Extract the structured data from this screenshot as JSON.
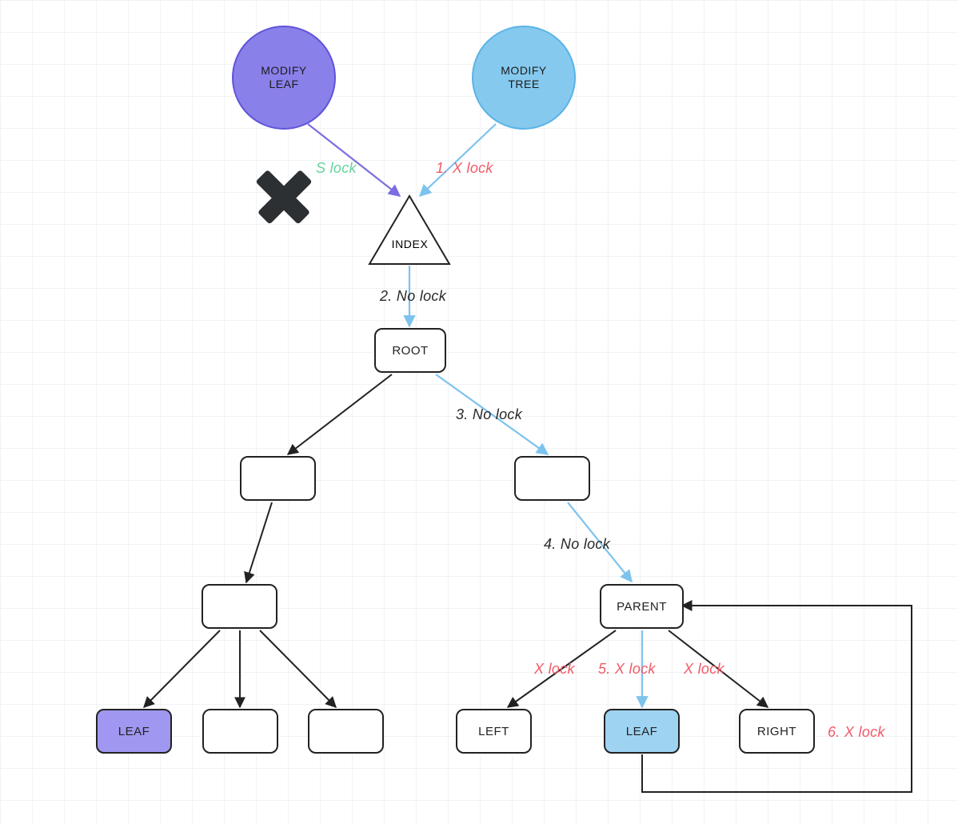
{
  "colors": {
    "purple_fill": "#8a80ea",
    "purple_stroke": "#5f54d8",
    "blue_fill": "#86c9ef",
    "blue_stroke": "#5bb3e6",
    "leaf_purple": "#9f97f0",
    "leaf_blue": "#9ed3f2",
    "edge_black": "#222222",
    "edge_blue": "#7cc3ed",
    "edge_purple": "#7a6fe0",
    "label_red": "#f25a68",
    "label_green": "#64d49a"
  },
  "nodes": {
    "modify_leaf": "MODIFY\nLEAF",
    "modify_tree": "MODIFY\nTREE",
    "index": "INDEX",
    "root": "ROOT",
    "parent": "PARENT",
    "left": "LEFT",
    "leaf_left": "LEAF",
    "leaf_right": "LEAF",
    "right": "RIGHT"
  },
  "labels": {
    "s_lock": "S lock",
    "x_lock_1": "1. X lock",
    "no_lock_2": "2. No lock",
    "no_lock_3": "3. No lock",
    "no_lock_4": "4. No lock",
    "x_lock_left": "X lock",
    "x_lock_5": "5. X lock",
    "x_lock_right": "X lock",
    "x_lock_6": "6. X lock"
  }
}
